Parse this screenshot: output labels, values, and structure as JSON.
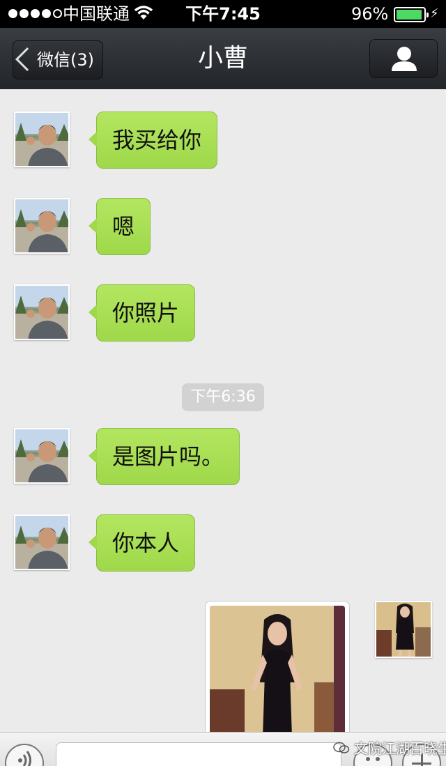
{
  "status_bar": {
    "carrier": "中国联通",
    "time": "下午7:45",
    "battery_percent": "96%",
    "battery_level": 0.96,
    "signal_bars": 4,
    "signal_max": 5
  },
  "nav": {
    "back_label": "微信(3)",
    "title": "小曹"
  },
  "messages": [
    {
      "side": "left",
      "text": "我买给你"
    },
    {
      "side": "left",
      "text": "嗯"
    },
    {
      "side": "left",
      "text": "你照片"
    },
    {
      "side": "left",
      "text": "是图片吗。"
    },
    {
      "side": "left",
      "text": "你本人"
    }
  ],
  "time_divider": "下午6:36",
  "watermark": "文院江湖百晓生",
  "colors": {
    "bubble_green": "#a8de52",
    "nav_dark": "#2b2e33",
    "chat_bg": "#ebebeb"
  }
}
